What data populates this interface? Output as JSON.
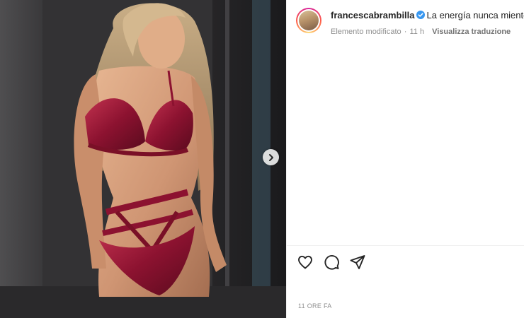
{
  "post": {
    "media": {
      "description_icon": "photo",
      "next_icon": "chevron-right-icon"
    },
    "header": {
      "username": "francescabrambilla",
      "verified_icon": "verified-badge-icon",
      "caption": "La energía nunca miente D",
      "edited_label": "Elemento modificato",
      "separator": "·",
      "time_ago": "11 h",
      "translate_label": "Visualizza traduzione"
    },
    "actions": {
      "like_icon": "heart-icon",
      "comment_icon": "comment-icon",
      "share_icon": "paper-plane-icon"
    },
    "timestamp": "11 ORE FA",
    "colors": {
      "verified": "#3897f0",
      "text": "#262626",
      "muted": "#8e8e8e",
      "divider": "#efefef"
    }
  }
}
